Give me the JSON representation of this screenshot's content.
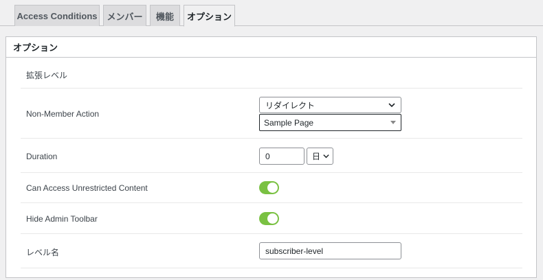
{
  "tabs": [
    {
      "label": "Access Conditions",
      "active": false
    },
    {
      "label": "メンバー",
      "active": false
    },
    {
      "label": "機能",
      "active": false
    },
    {
      "label": "オプション",
      "active": true
    }
  ],
  "panel": {
    "title": "オプション",
    "section_heading": "拡張レベル",
    "non_member_action": {
      "label": "Non-Member Action",
      "action_value": "リダイレクト",
      "page_value": "Sample Page"
    },
    "duration": {
      "label": "Duration",
      "value": "0",
      "unit": "日"
    },
    "unrestricted": {
      "label": "Can Access Unrestricted Content",
      "enabled": true
    },
    "hide_toolbar": {
      "label": "Hide Admin Toolbar",
      "enabled": true
    },
    "level_name": {
      "label": "レベル名",
      "value": "subscriber-level"
    }
  },
  "colors": {
    "toggle_on": "#7ac142",
    "tab_inactive": "#dcdcde",
    "border": "#c3c4c7"
  }
}
